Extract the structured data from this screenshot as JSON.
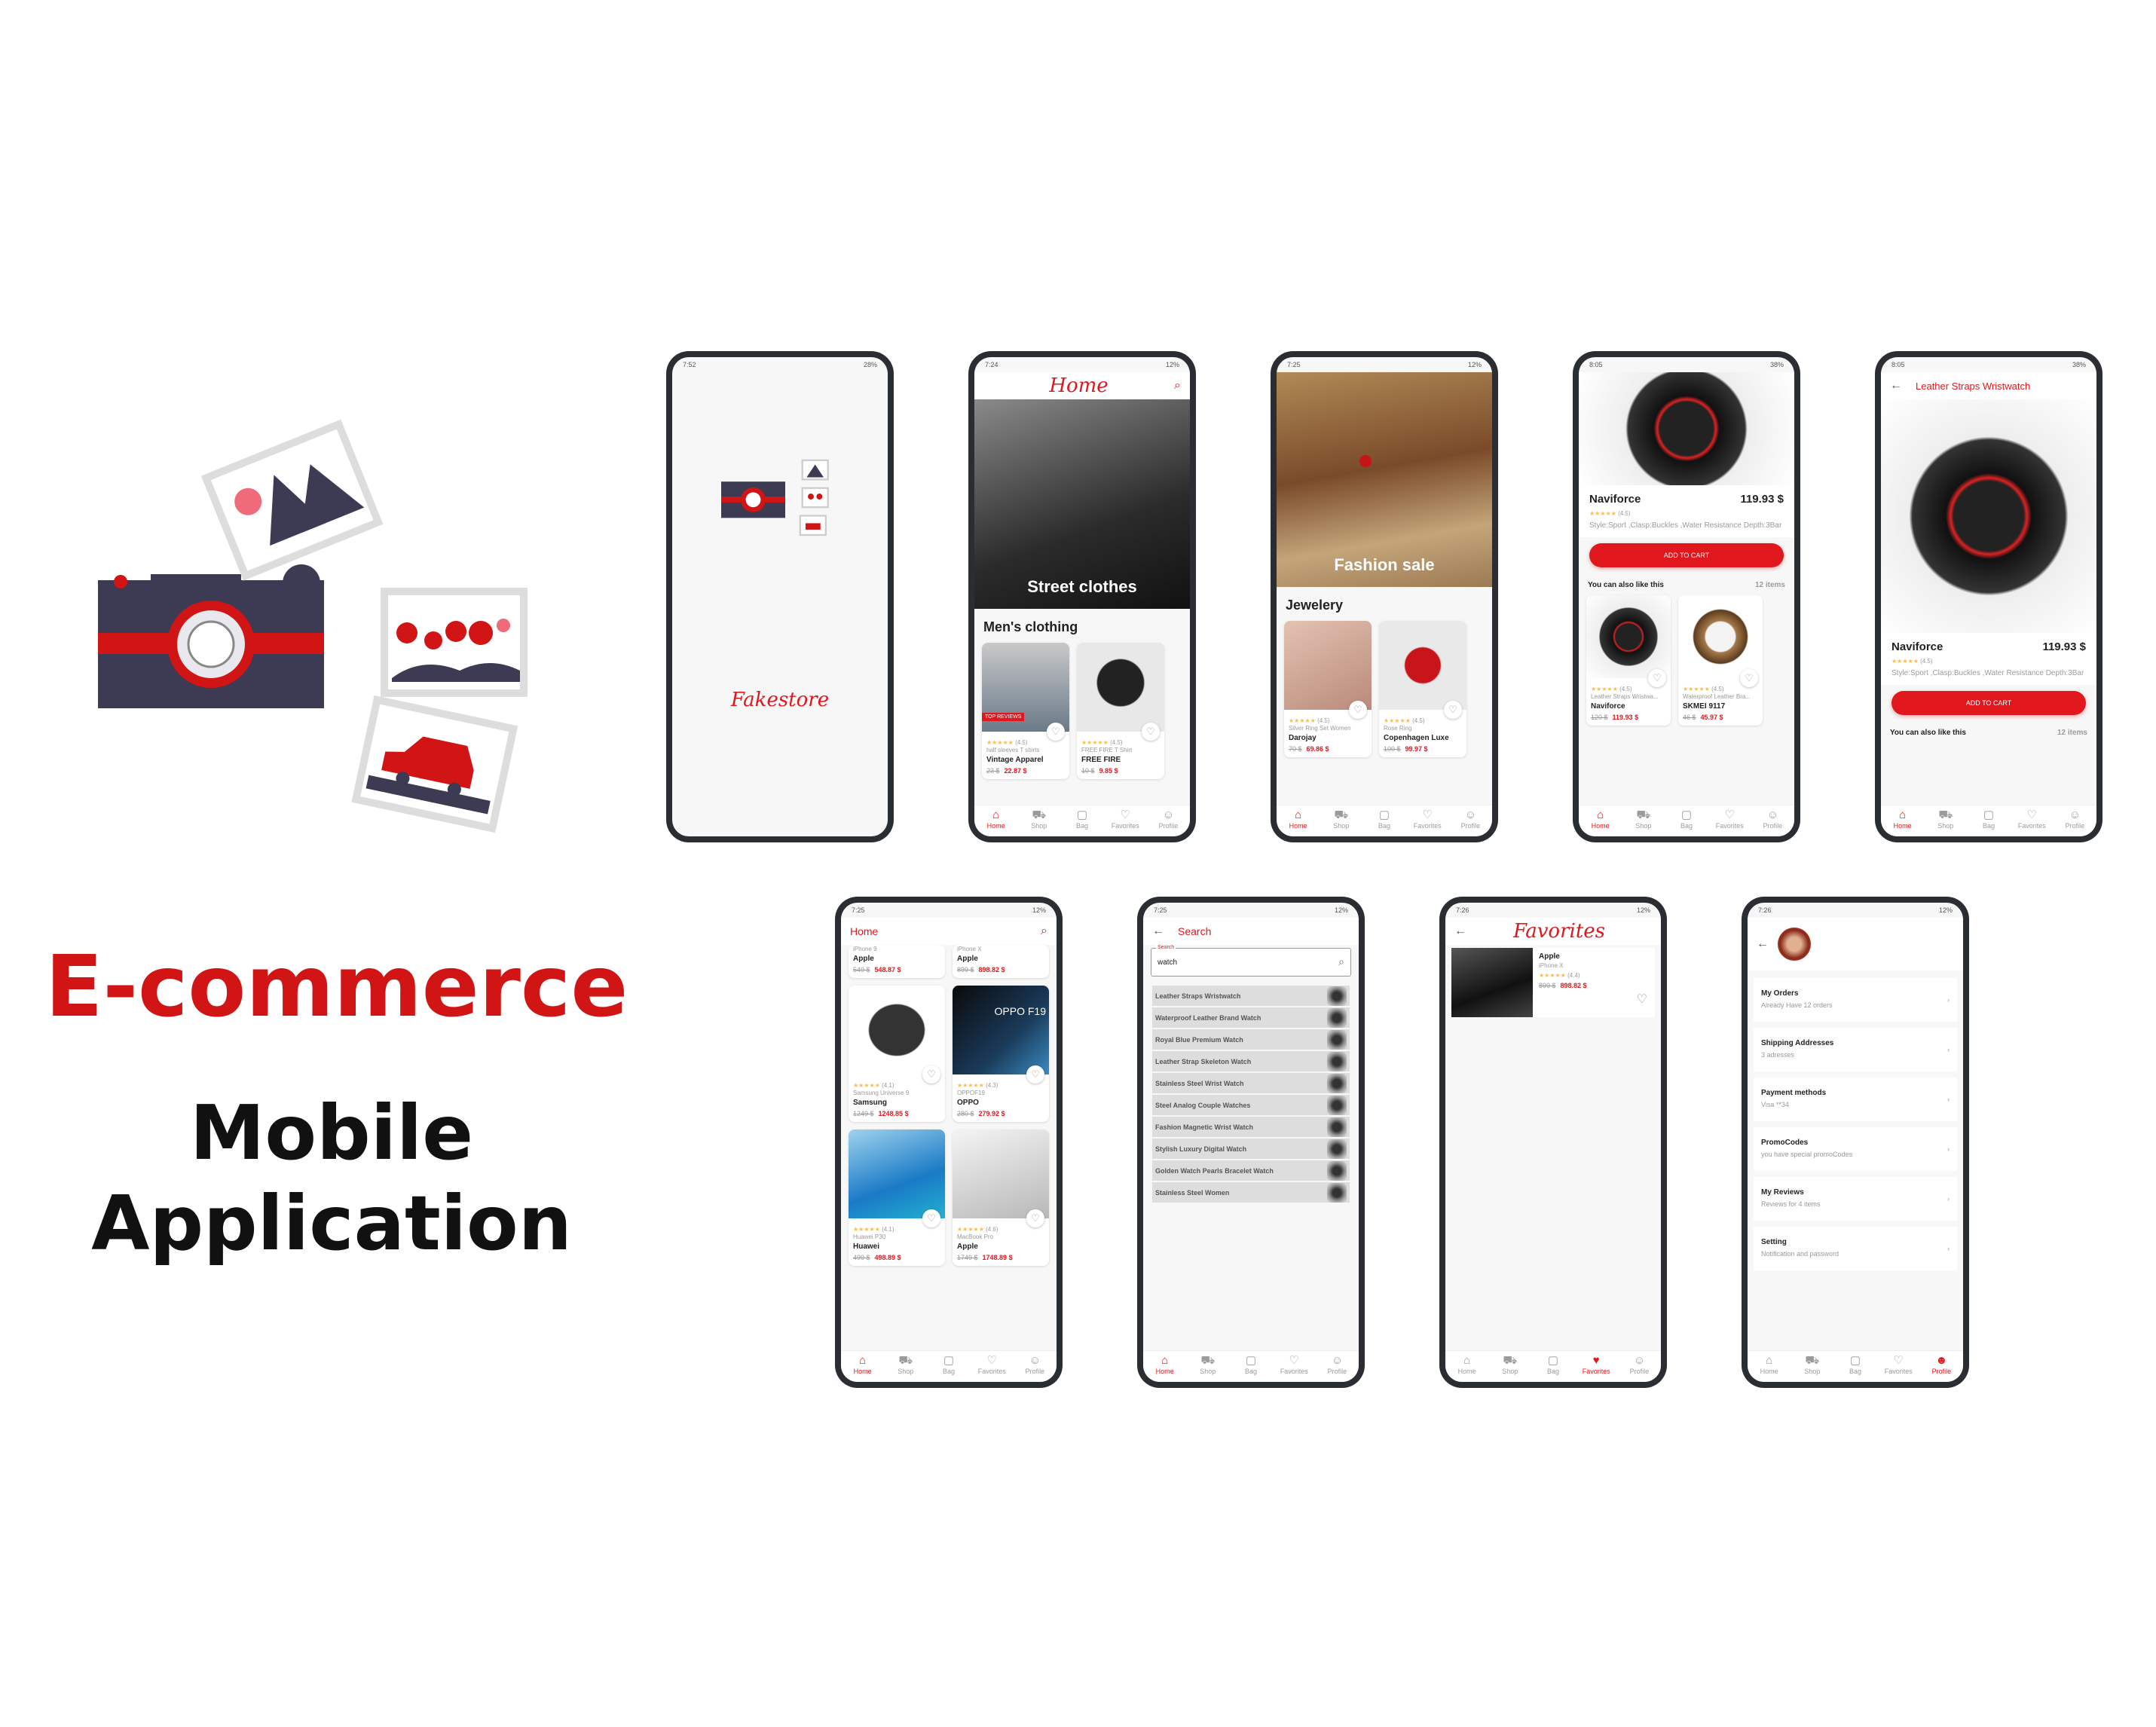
{
  "brand": {
    "primary": "#e0171c",
    "dark": "#3d3a53"
  },
  "headline": {
    "line1": "E-commerce",
    "line2": "Mobile",
    "line3": "Application"
  },
  "nav": [
    "Home",
    "Shop",
    "Bag",
    "Favorites",
    "Profile"
  ],
  "splash": {
    "status_time": "7:52",
    "battery": "28%",
    "brand": "Fakestore"
  },
  "home": {
    "status_time": "7:24",
    "battery": "12%",
    "title": "Home",
    "hero": "Street clothes",
    "section": "Men's clothing",
    "products": [
      {
        "rating": "(4.5)",
        "category": "half sleeves T shirts",
        "name": "Vintage Apparel",
        "old": "23 $",
        "new": "22.87 $",
        "badge": "TOP REVIEWS"
      },
      {
        "rating": "(4.5)",
        "category": "FREE FIRE T Shirt",
        "name": "FREE FIRE",
        "old": "10 $",
        "new": "9.85 $"
      }
    ]
  },
  "fashion": {
    "status_time": "7:25",
    "battery": "12%",
    "hero": "Fashion sale",
    "section": "Jewelery",
    "products": [
      {
        "rating": "(4.5)",
        "category": "Silver Ring Set Women",
        "name": "Darojay",
        "old": "70 $",
        "new": "69.86 $"
      },
      {
        "rating": "(4.5)",
        "category": "Rose Ring",
        "name": "Copenhagen Luxe",
        "old": "100 $",
        "new": "99.97 $"
      }
    ]
  },
  "detail1": {
    "status_time": "8:05",
    "battery": "38%",
    "name": "Naviforce",
    "price": "119.93 $",
    "rating": "(4.5)",
    "desc": "Style:Sport ,Clasp:Buckles ,Water Resistance Depth:3Bar",
    "button": "ADD TO CART",
    "also": "You can also like this",
    "count": "12 items",
    "products": [
      {
        "rating": "(4.5)",
        "category": "Leather Straps Wristwa...",
        "name": "Naviforce",
        "old": "120 $",
        "new": "119.93 $"
      },
      {
        "rating": "(4.5)",
        "category": "Waterproof Leather Bra...",
        "name": "SKMEI 9117",
        "old": "46 $",
        "new": "45.97 $"
      }
    ]
  },
  "detail2": {
    "status_time": "8:05",
    "battery": "38%",
    "title": "Leather Straps Wristwatch",
    "name": "Naviforce",
    "price": "119.93 $",
    "rating": "(4.5)",
    "desc": "Style:Sport ,Clasp:Buckles ,Water Resistance Depth:3Bar",
    "button": "ADD TO CART",
    "also": "You can also like this",
    "count": "12 items"
  },
  "home2": {
    "status_time": "7:25",
    "battery": "12%",
    "title": "Home",
    "products": [
      {
        "category": "iPhone 9",
        "name": "Apple",
        "old": "549 $",
        "new": "548.87 $"
      },
      {
        "category": "iPhone X",
        "name": "Apple",
        "old": "899 $",
        "new": "898.82 $"
      },
      {
        "rating": "(4.1)",
        "category": "Samsung Universe 9",
        "name": "Samsung",
        "old": "1249 $",
        "new": "1248.85 $"
      },
      {
        "rating": "(4.3)",
        "category": "OPPOF19",
        "name": "OPPO",
        "old": "280 $",
        "new": "279.92 $",
        "img_text": "OPPO F19"
      },
      {
        "rating": "(4.1)",
        "category": "Huawei P30",
        "name": "Huawei",
        "old": "499 $",
        "new": "498.89 $"
      },
      {
        "rating": "(4.6)",
        "category": "MacBook Pro",
        "name": "Apple",
        "old": "1749 $",
        "new": "1748.89 $"
      }
    ]
  },
  "search": {
    "status_time": "7:25",
    "battery": "12%",
    "title": "Search",
    "label": "Search",
    "value": "watch",
    "results": [
      "Leather Straps Wristwatch",
      "Waterproof Leather Brand Watch",
      "Royal Blue Premium Watch",
      "Leather Strap Skeleton Watch",
      "Stainless Steel Wrist Watch",
      "Steel Analog Couple Watches",
      "Fashion Magnetic Wrist Watch",
      "Stylish Luxury Digital Watch",
      "Golden Watch Pearls Bracelet Watch",
      "Stainless Steel Women"
    ]
  },
  "favorites": {
    "status_time": "7:26",
    "battery": "12%",
    "title": "Favorites",
    "item": {
      "name": "Apple",
      "category": "iPhone X",
      "rating": "(4.4)",
      "old": "899 $",
      "new": "898.82 $"
    }
  },
  "profile": {
    "status_time": "7:26",
    "battery": "12%",
    "items": [
      {
        "title": "My Orders",
        "sub": "Already Have 12 orders"
      },
      {
        "title": "Shipping Addresses",
        "sub": "3 adresses"
      },
      {
        "title": "Payment methods",
        "sub": "Visa **34"
      },
      {
        "title": "PromoCodes",
        "sub": "you have special promoCodes"
      },
      {
        "title": "My Reviews",
        "sub": "Reviews for 4 items"
      },
      {
        "title": "Setting",
        "sub": "Notification and password"
      }
    ]
  }
}
